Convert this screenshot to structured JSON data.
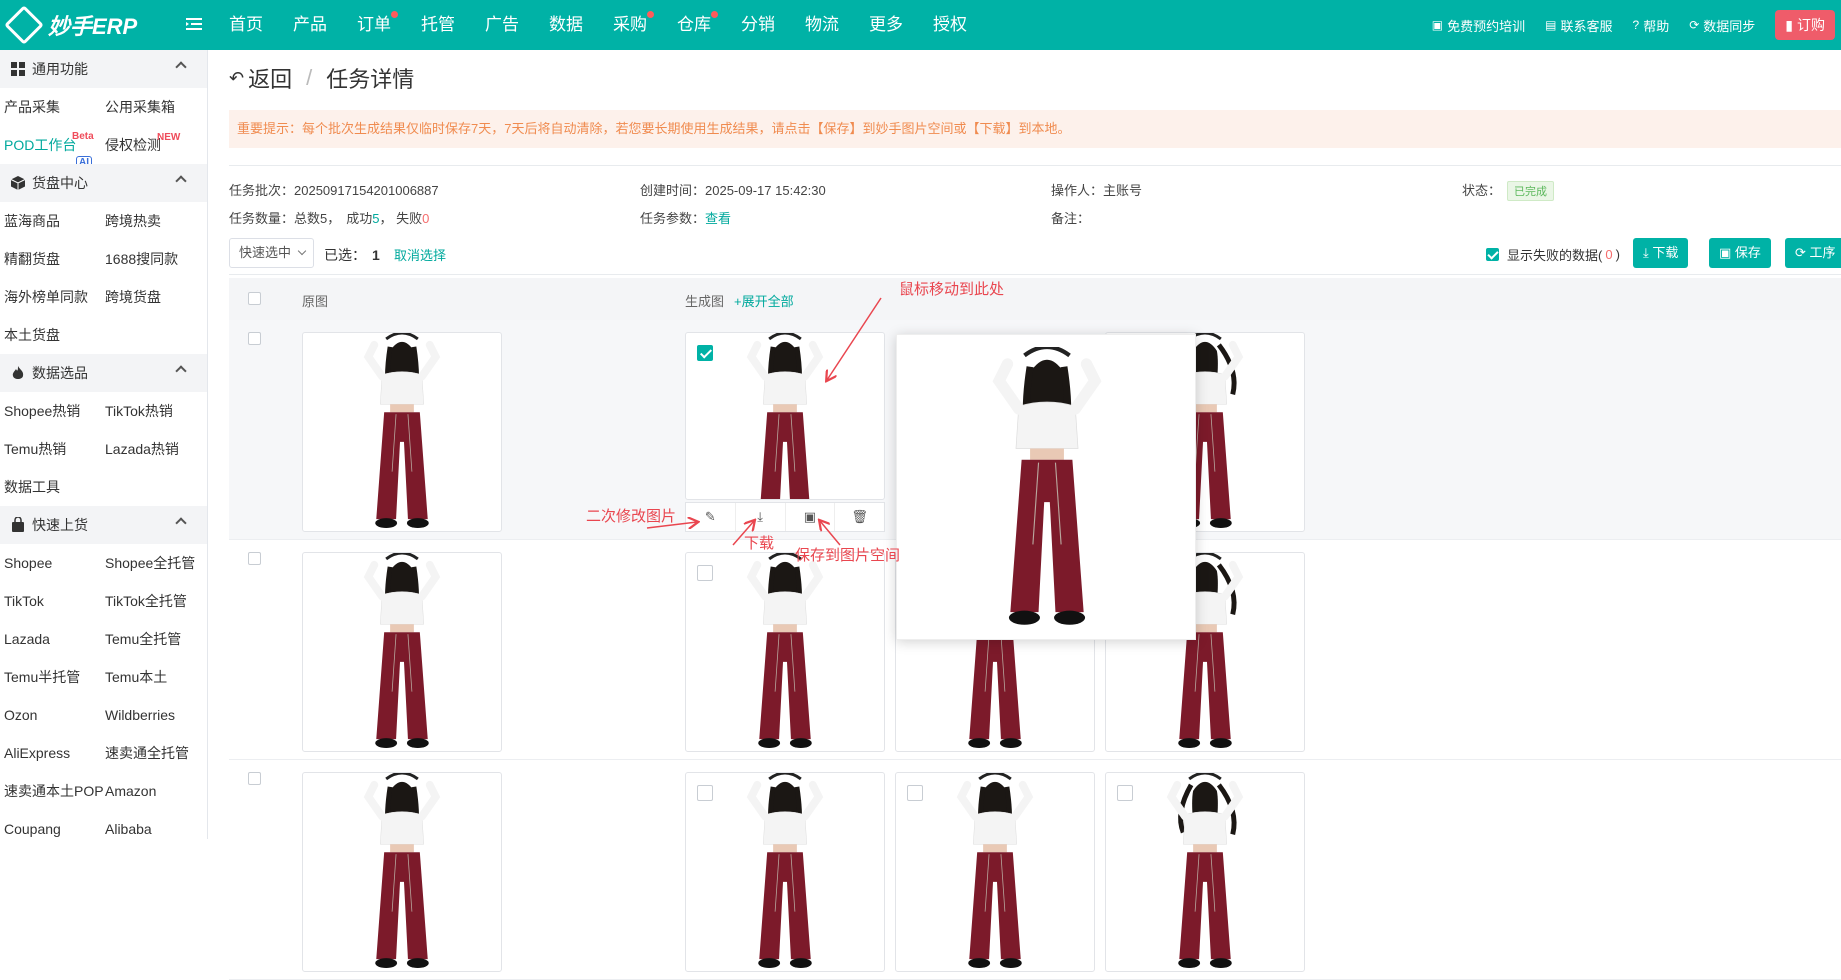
{
  "header": {
    "logo_text": "妙手ERP",
    "menu_icon": "menu-fold-icon",
    "nav": [
      {
        "label": "首页",
        "dot": false
      },
      {
        "label": "产品",
        "dot": false
      },
      {
        "label": "订单",
        "dot": true
      },
      {
        "label": "托管",
        "dot": false
      },
      {
        "label": "广告",
        "dot": false
      },
      {
        "label": "数据",
        "dot": false
      },
      {
        "label": "采购",
        "dot": true
      },
      {
        "label": "仓库",
        "dot": true
      },
      {
        "label": "分销",
        "dot": false
      },
      {
        "label": "物流",
        "dot": false
      },
      {
        "label": "更多",
        "dot": false
      },
      {
        "label": "授权",
        "dot": false
      }
    ],
    "right": {
      "training": "免费预约培训",
      "support": "联系客服",
      "help": "帮助",
      "sync": "数据同步",
      "order": "订购"
    }
  },
  "sidebar": {
    "sections": [
      {
        "title": "通用功能",
        "icon": "grid-icon",
        "links": [
          "产品采集",
          "公用采集箱",
          "POD工作台",
          "侵权检测"
        ]
      },
      {
        "title": "货盘中心",
        "icon": "box-icon",
        "links": [
          "蓝海商品",
          "跨境热卖",
          "精翻货盘",
          "1688搜同款",
          "海外榜单同款",
          "跨境货盘",
          "本土货盘"
        ]
      },
      {
        "title": "数据选品",
        "icon": "fire-icon",
        "links": [
          "Shopee热销",
          "TikTok热销",
          "Temu热销",
          "Lazada热销",
          "数据工具"
        ]
      },
      {
        "title": "快速上货",
        "icon": "bag-icon",
        "links": [
          "Shopee",
          "Shopee全托管",
          "TikTok",
          "TikTok全托管",
          "Lazada",
          "Temu全托管",
          "Temu半托管",
          "Temu本土",
          "Ozon",
          "Wildberries",
          "AliExpress",
          "速卖通全托管",
          "速卖通本土POP",
          "Amazon",
          "Coupang",
          "Alibaba"
        ]
      }
    ],
    "badges": {
      "beta": "Beta",
      "new": "NEW",
      "ai": "AI"
    }
  },
  "breadcrumb": {
    "back": "返回",
    "separator": "/",
    "current": "任务详情"
  },
  "notice": "重要提示：每个批次生成结果仅临时保存7天，7天后将自动清除，若您要长期使用生成结果，请点击【保存】到妙手图片空间或【下载】到本地。",
  "task": {
    "batch_label": "任务批次：",
    "batch": "20250917154201006887",
    "created_label": "创建时间：",
    "created": "2025-09-17 15:42:30",
    "operator_label": "操作人：",
    "operator": "主账号",
    "status_label": "状态：",
    "status": "已完成",
    "count_label": "任务数量：",
    "total": "总数5，",
    "success_label": "成功",
    "success": "5",
    "fail_label": "， 失败",
    "fail": "0",
    "params_label": "任务参数：",
    "params_link": "查看",
    "remark_label": "备注："
  },
  "toolbar": {
    "quick_select": "快速选中",
    "selected_label": "已选：",
    "selected_count": "1",
    "cancel": "取消选择",
    "show_failed": "显示失败的数据(",
    "failed_count": "0",
    "show_failed_end": ")",
    "download": "下载",
    "save": "保存",
    "tools": "工序"
  },
  "table": {
    "col_original": "原图",
    "col_generated": "生成图",
    "expand_all": "+展开全部"
  },
  "annotations": {
    "hover": "鼠标移动到此处",
    "edit": "二次修改图片",
    "download": "下载",
    "save": "保存到图片空间"
  },
  "colors": {
    "brand": "#00b2a6",
    "annotation": "#e9464f",
    "notice_text": "#f08b4f"
  }
}
